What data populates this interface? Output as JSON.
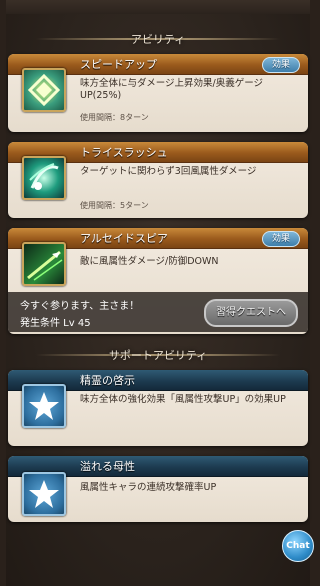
{
  "sections": {
    "ability_header": "アビリティ",
    "support_header": "サポートアビリティ"
  },
  "abilities": [
    {
      "name": "スピードアップ",
      "badge": "効果",
      "description": "味方全体に与ダメージ上昇効果/奥義ゲージUP(25%)",
      "cooldown": "使用間隔：8ターン",
      "icon": "speed-up-icon"
    },
    {
      "name": "トライスラッシュ",
      "description": "ターゲットに関わらず3回風属性ダメージ",
      "cooldown": "使用間隔：5ターン",
      "icon": "tri-slash-icon"
    },
    {
      "name": "アルセイドスピア",
      "badge": "効果",
      "description": "敵に風属性ダメージ/防御DOWN",
      "icon": "alseid-spear-icon",
      "locked_message": "今すぐ参ります、主さま！",
      "unlock_condition": "発生条件 Lv 45",
      "quest_button": "習得クエストへ"
    }
  ],
  "support_abilities": [
    {
      "name": "精霊の啓示",
      "description": "味方全体の強化効果「風属性攻撃UP」の効果UP",
      "icon": "star-icon"
    },
    {
      "name": "溢れる母性",
      "description": "風属性キャラの連続攻撃確率UP",
      "icon": "star-icon"
    }
  ],
  "chat_button": "Chat",
  "colors": {
    "ability_title_bar": "#9a5a1c",
    "support_title_bar": "#1d3b50",
    "badge": "#3e7eaa",
    "card_bg": "#ece3d6"
  }
}
